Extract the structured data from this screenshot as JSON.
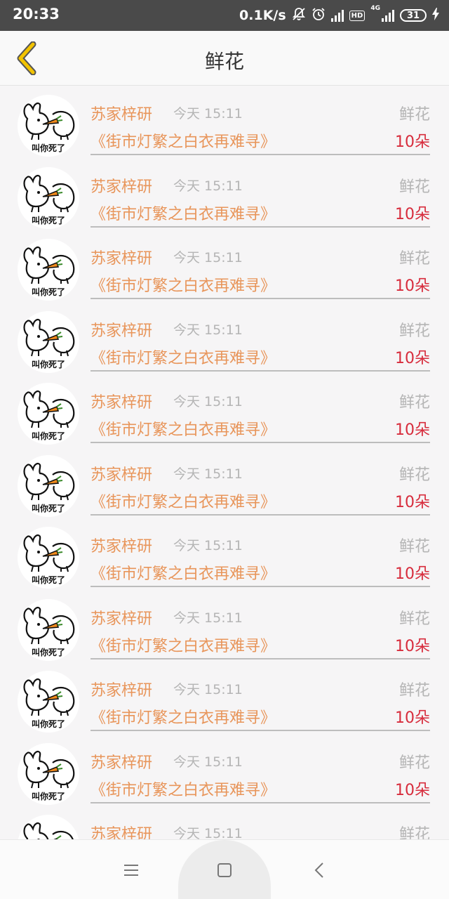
{
  "status_bar": {
    "time": "20:33",
    "network_speed": "0.1K/s",
    "network_type": "4G",
    "hd_label": "HD",
    "battery": "31"
  },
  "header": {
    "title": "鲜花",
    "back_icon": "chevron-left-icon",
    "accent_color": "#f2c300"
  },
  "list": {
    "items": [
      {
        "sender": "苏家梓研",
        "time": "今天 15:11",
        "gift_type": "鲜花",
        "book_title": "《街市灯繁之白衣再难寻》",
        "amount": "10朵"
      },
      {
        "sender": "苏家梓研",
        "time": "今天 15:11",
        "gift_type": "鲜花",
        "book_title": "《街市灯繁之白衣再难寻》",
        "amount": "10朵"
      },
      {
        "sender": "苏家梓研",
        "time": "今天 15:11",
        "gift_type": "鲜花",
        "book_title": "《街市灯繁之白衣再难寻》",
        "amount": "10朵"
      },
      {
        "sender": "苏家梓研",
        "time": "今天 15:11",
        "gift_type": "鲜花",
        "book_title": "《街市灯繁之白衣再难寻》",
        "amount": "10朵"
      },
      {
        "sender": "苏家梓研",
        "time": "今天 15:11",
        "gift_type": "鲜花",
        "book_title": "《街市灯繁之白衣再难寻》",
        "amount": "10朵"
      },
      {
        "sender": "苏家梓研",
        "time": "今天 15:11",
        "gift_type": "鲜花",
        "book_title": "《街市灯繁之白衣再难寻》",
        "amount": "10朵"
      },
      {
        "sender": "苏家梓研",
        "time": "今天 15:11",
        "gift_type": "鲜花",
        "book_title": "《街市灯繁之白衣再难寻》",
        "amount": "10朵"
      },
      {
        "sender": "苏家梓研",
        "time": "今天 15:11",
        "gift_type": "鲜花",
        "book_title": "《街市灯繁之白衣再难寻》",
        "amount": "10朵"
      },
      {
        "sender": "苏家梓研",
        "time": "今天 15:11",
        "gift_type": "鲜花",
        "book_title": "《街市灯繁之白衣再难寻》",
        "amount": "10朵"
      },
      {
        "sender": "苏家梓研",
        "time": "今天 15:11",
        "gift_type": "鲜花",
        "book_title": "《街市灯繁之白衣再难寻》",
        "amount": "10朵"
      },
      {
        "sender": "苏家梓研",
        "time": "今天 15:11",
        "gift_type": "鲜花",
        "book_title": "",
        "amount": ""
      }
    ],
    "avatar_caption": "叫你死了",
    "colors": {
      "name": "#e8955a",
      "meta": "#b5b5b5",
      "amount": "#d72c3c"
    }
  },
  "nav_bar": {
    "menu_icon": "menu-icon",
    "home_icon": "square-home-icon",
    "back_icon": "back-triangle-icon"
  }
}
